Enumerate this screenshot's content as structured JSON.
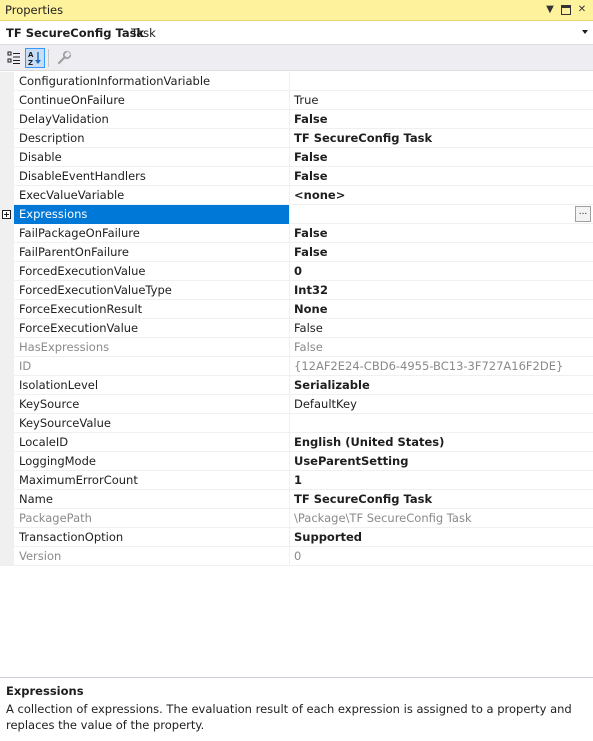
{
  "window": {
    "title": "Properties"
  },
  "object_selector": {
    "name": "TF SecureConfig Task",
    "type": "Task"
  },
  "toolbar": {
    "categorized_icon": "categorized-icon",
    "alphabetical_icon": "alphabetical-icon",
    "property_pages_icon": "wrench-icon"
  },
  "properties": [
    {
      "name": "ConfigurationInformationVariable",
      "value": ""
    },
    {
      "name": "ContinueOnFailure",
      "value": "True"
    },
    {
      "name": "DelayValidation",
      "value": "False"
    },
    {
      "name": "Description",
      "value": "TF SecureConfig Task"
    },
    {
      "name": "Disable",
      "value": "False"
    },
    {
      "name": "DisableEventHandlers",
      "value": "False"
    },
    {
      "name": "ExecValueVariable",
      "value": "<none>"
    },
    {
      "name": "Expressions",
      "value": ""
    },
    {
      "name": "FailPackageOnFailure",
      "value": "False"
    },
    {
      "name": "FailParentOnFailure",
      "value": "False"
    },
    {
      "name": "ForcedExecutionValue",
      "value": "0"
    },
    {
      "name": "ForcedExecutionValueType",
      "value": "Int32"
    },
    {
      "name": "ForceExecutionResult",
      "value": "None"
    },
    {
      "name": "ForceExecutionValue",
      "value": "False"
    },
    {
      "name": "HasExpressions",
      "value": "False"
    },
    {
      "name": "ID",
      "value": "{12AF2E24-CBD6-4955-BC13-3F727A16F2DE}"
    },
    {
      "name": "IsolationLevel",
      "value": "Serializable"
    },
    {
      "name": "KeySource",
      "value": "DefaultKey"
    },
    {
      "name": "KeySourceValue",
      "value": ""
    },
    {
      "name": "LocaleID",
      "value": "English (United States)"
    },
    {
      "name": "LoggingMode",
      "value": "UseParentSetting"
    },
    {
      "name": "MaximumErrorCount",
      "value": "1"
    },
    {
      "name": "Name",
      "value": "TF SecureConfig Task"
    },
    {
      "name": "PackagePath",
      "value": "\\Package\\TF SecureConfig Task"
    },
    {
      "name": "TransactionOption",
      "value": "Supported"
    },
    {
      "name": "Version",
      "value": "0"
    }
  ],
  "ellipsis_label": "...",
  "description": {
    "title": "Expressions",
    "text": "A collection of expressions. The evaluation result of each expression is assigned to a property and replaces the value of the property."
  },
  "colors": {
    "title_bar": "#fff29d",
    "selection": "#0078d7",
    "disabled_text": "#8a8a8a"
  }
}
